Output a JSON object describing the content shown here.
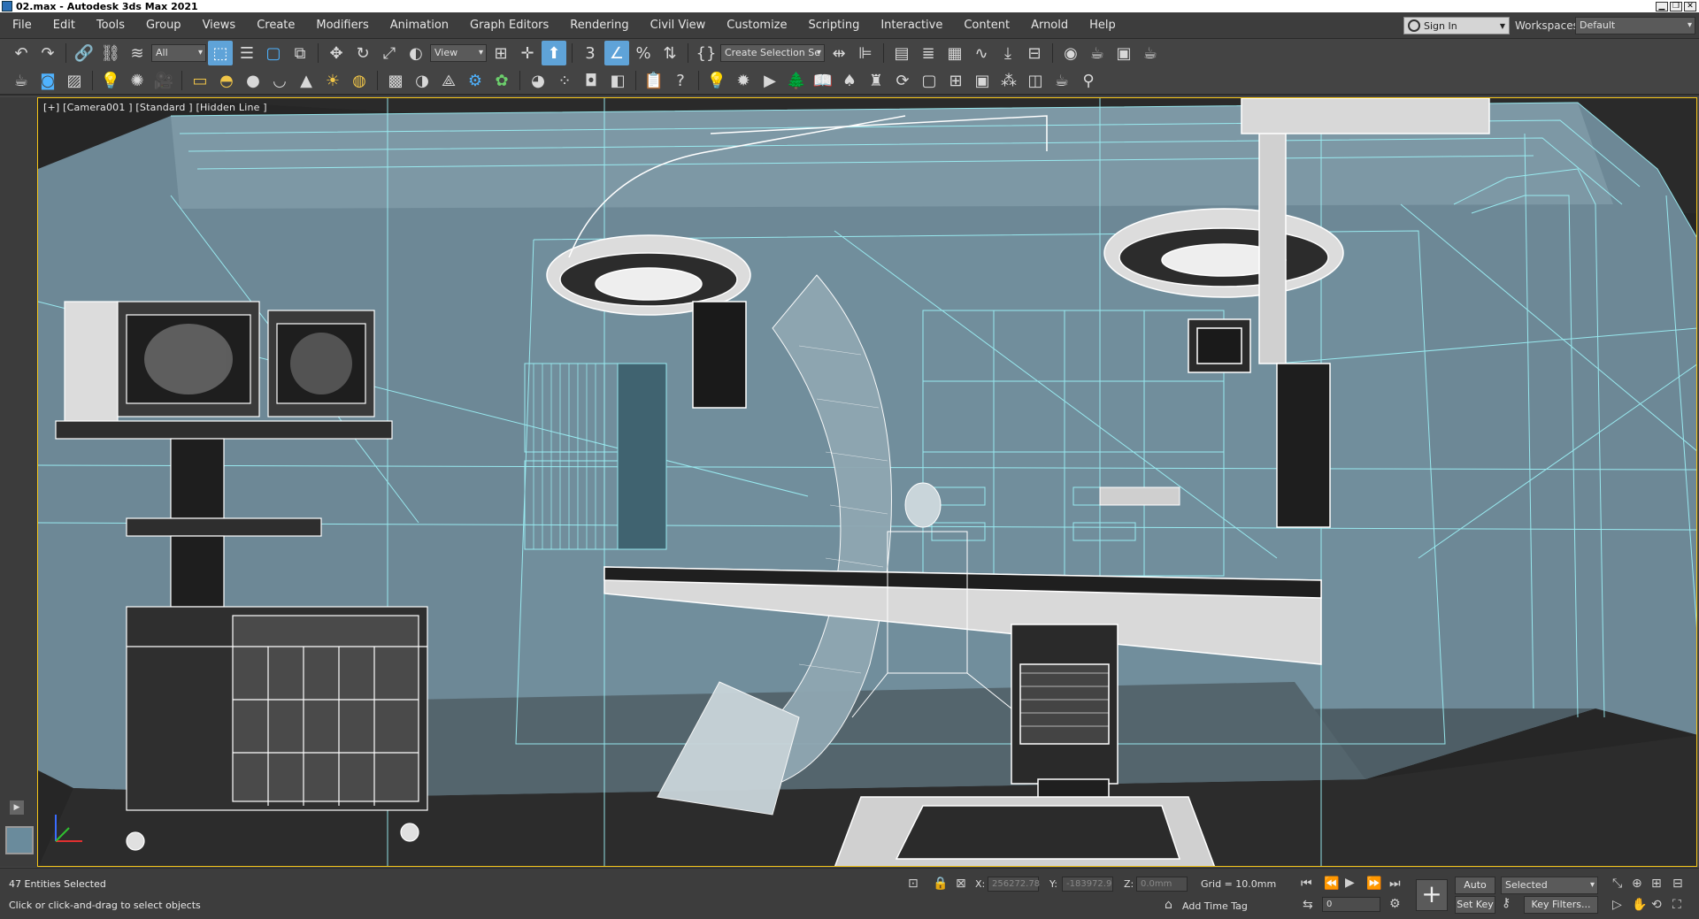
{
  "window": {
    "title": "02.max - Autodesk 3ds Max 2021",
    "min": "▁",
    "max": "❐",
    "close": "✕"
  },
  "menu": [
    "File",
    "Edit",
    "Tools",
    "Group",
    "Views",
    "Create",
    "Modifiers",
    "Animation",
    "Graph Editors",
    "Rendering",
    "Civil View",
    "Customize",
    "Scripting",
    "Interactive",
    "Content",
    "Arnold",
    "Help"
  ],
  "account": {
    "sign_in": "Sign In",
    "workspaces_label": "Workspaces:",
    "workspace": "Default"
  },
  "toolbar": {
    "selection_filter": "All",
    "ref_coord": "View",
    "named_selection": "Create Selection Se"
  },
  "viewport": {
    "label": "[+] [Camera001 ] [Standard ] [Hidden Line ]",
    "background": "#6b8795",
    "wire_color": "#8fe8f0"
  },
  "status": {
    "selection": "47 Entities Selected",
    "prompt": "Click or click-and-drag to select objects",
    "x_label": "X:",
    "x_value": "256272.78",
    "y_label": "Y:",
    "y_value": "-183972.9",
    "z_label": "Z:",
    "z_value": "0.0mm",
    "grid": "Grid = 10.0mm",
    "add_time_tag": "Add Time Tag",
    "auto_key": "Auto Key",
    "set_key": "Set Key",
    "key_mode": "Selected",
    "key_filters": "Key Filters...",
    "frame": "0"
  }
}
